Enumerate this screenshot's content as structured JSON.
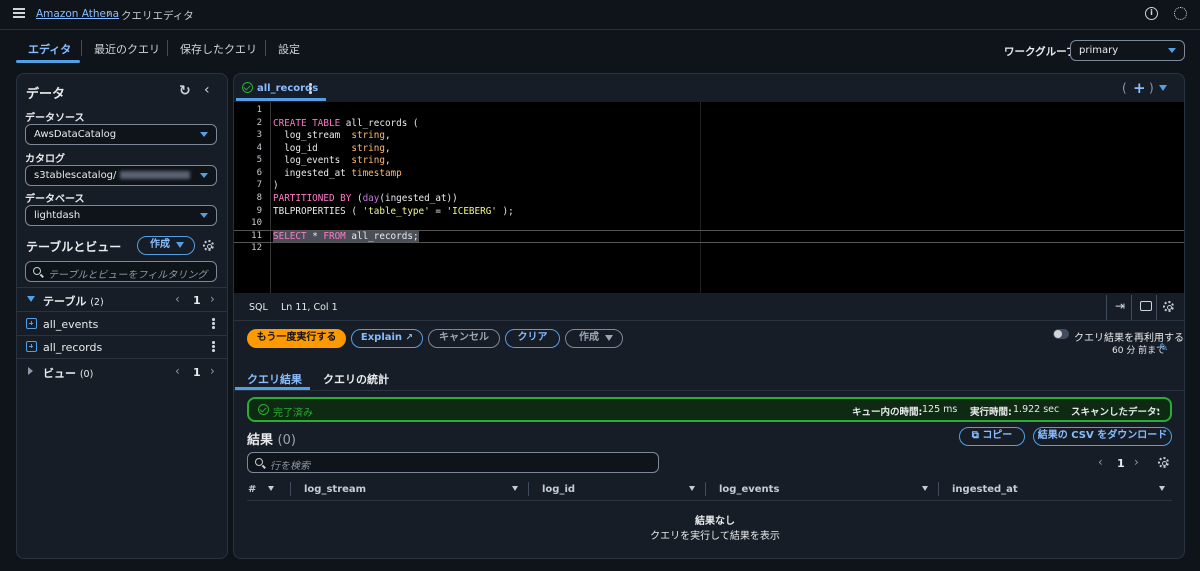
{
  "header": {
    "breadcrumb_link": "Amazon Athena",
    "breadcrumb_current": "クエリエディタ"
  },
  "tabs": [
    {
      "label": "エディタ",
      "active": true
    },
    {
      "label": "最近のクエリ"
    },
    {
      "label": "保存したクエリ"
    },
    {
      "label": "設定"
    }
  ],
  "workgroup": {
    "label": "ワークグループ",
    "value": "primary"
  },
  "data_panel": {
    "title": "データ",
    "datasource_label": "データソース",
    "datasource_value": "AwsDataCatalog",
    "catalog_label": "カタログ",
    "catalog_value": "s3tablescatalog/",
    "database_label": "データベース",
    "database_value": "lightdash",
    "tables_views_title": "テーブルとビュー",
    "create_button": "作成",
    "filter_placeholder": "テーブルとビューをフィルタリング",
    "tables_label": "テーブル",
    "tables_count": "(2)",
    "tables_page": "1",
    "tables": [
      "all_events",
      "all_records"
    ],
    "views_label": "ビュー",
    "views_count": "(0)",
    "views_page": "1"
  },
  "editor": {
    "tab_name": "all_records",
    "line_numbers": [
      "1",
      "2",
      "3",
      "4",
      "5",
      "6",
      "7",
      "8",
      "9",
      "10",
      "11",
      "12"
    ],
    "status_lang": "SQL",
    "status_pos": "Ln 11, Col 1"
  },
  "actions": {
    "rerun": "もう一度実行する",
    "explain": "Explain",
    "cancel": "キャンセル",
    "clear": "クリア",
    "create": "作成",
    "reuse_label": "クエリ結果を再利用する",
    "reuse_sub": "60 分 前まで"
  },
  "results": {
    "tab_results": "クエリ結果",
    "tab_stats": "クエリの統計",
    "status": "完了済み",
    "queue_label": "キュー内の時間:",
    "queue_value": "125 ms",
    "exec_label": "実行時間:",
    "exec_value": "1.922 sec",
    "scanned_label": "スキャンしたデータ:",
    "scanned_value": "-",
    "title": "結果",
    "count": "(0)",
    "copy_button": "コピー",
    "download_button": "結果の CSV をダウンロード",
    "search_placeholder": "行を検索",
    "page": "1",
    "columns": [
      "#",
      "log_stream",
      "log_id",
      "log_events",
      "ingested_at"
    ],
    "empty_title": "結果なし",
    "empty_sub": "クエリを実行して結果を表示"
  },
  "colors": {
    "accent": "#539fe5",
    "primary_button": "#ff9900",
    "success": "#29ad32"
  }
}
